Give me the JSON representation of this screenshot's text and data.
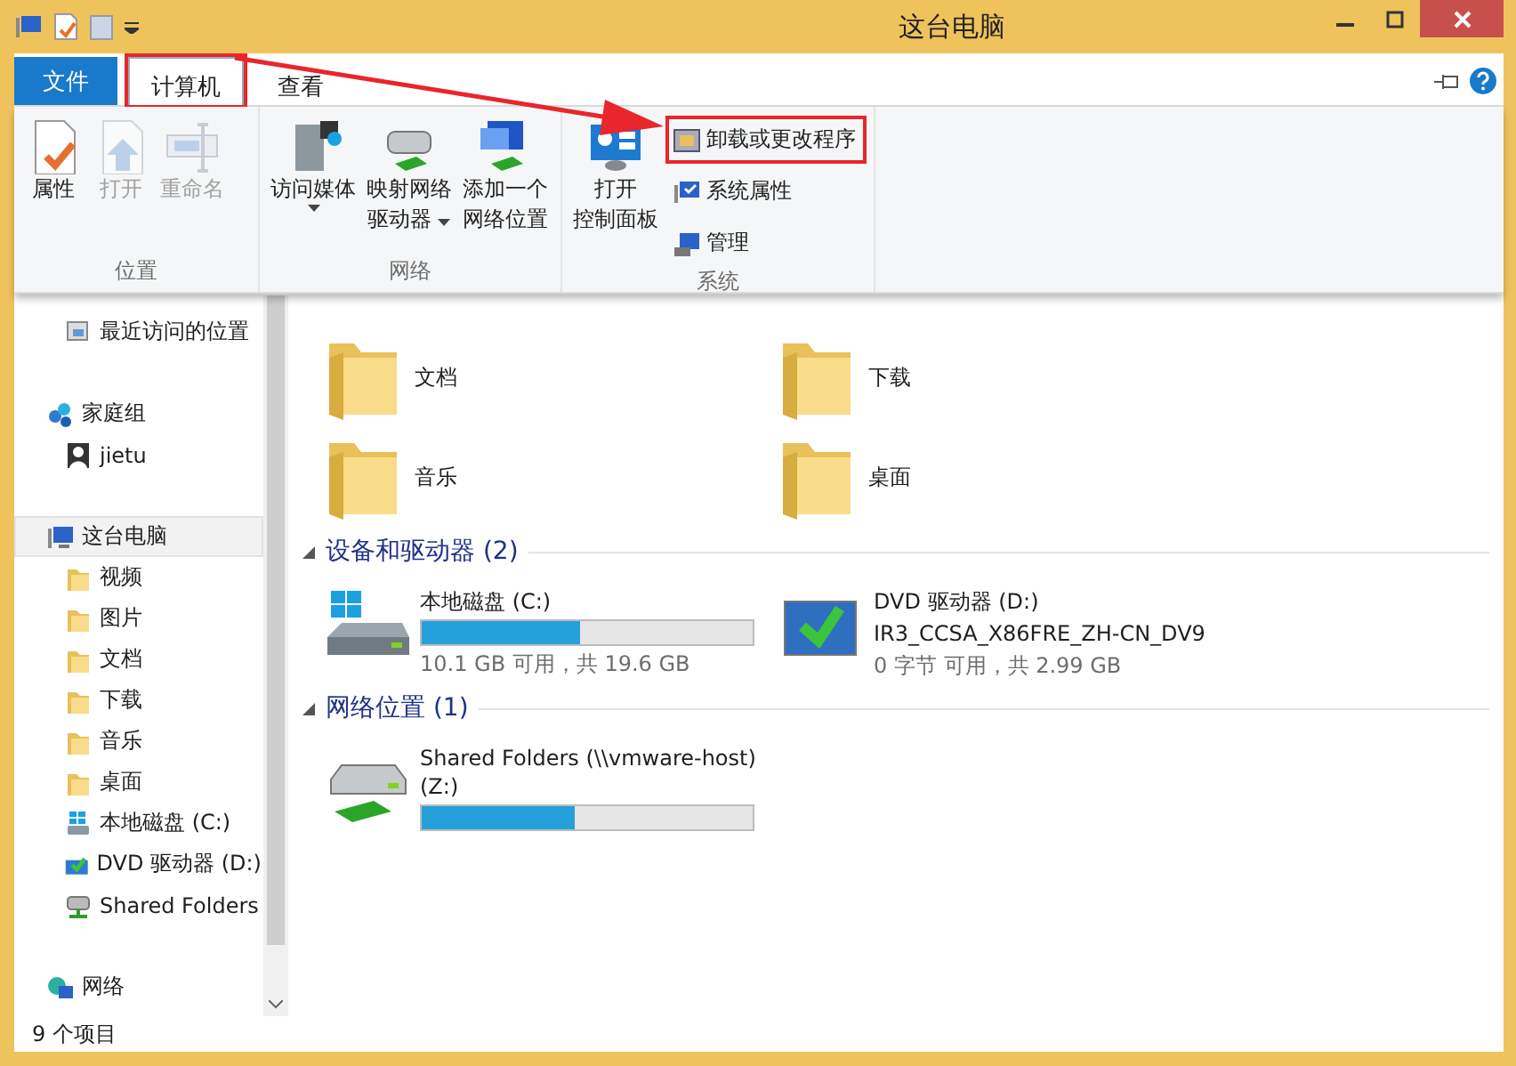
{
  "window": {
    "title": "这台电脑"
  },
  "tabs": [
    {
      "label": "文件",
      "kind": "file",
      "selected": false
    },
    {
      "label": "计算机",
      "kind": "tab",
      "selected": true,
      "highlighted": true
    },
    {
      "label": "查看",
      "kind": "tab",
      "selected": false
    }
  ],
  "ribbon": {
    "groups": [
      {
        "label": "位置",
        "buttons": [
          {
            "lines": [
              "属性"
            ],
            "kind": "properties",
            "disabled": false
          },
          {
            "lines": [
              "打开"
            ],
            "kind": "open",
            "disabled": true
          },
          {
            "lines": [
              "重命名"
            ],
            "kind": "rename",
            "disabled": true
          }
        ]
      },
      {
        "label": "网络",
        "buttons": [
          {
            "lines": [
              "访问媒体"
            ],
            "kind": "media",
            "disabled": false,
            "dropdown": true
          },
          {
            "lines": [
              "映射网络",
              "驱动器"
            ],
            "kind": "mapdrive",
            "disabled": false,
            "dropdown": true
          },
          {
            "lines": [
              "添加一个",
              "网络位置"
            ],
            "kind": "netlocation",
            "disabled": false
          }
        ]
      },
      {
        "label": "系统",
        "buttons": [
          {
            "lines": [
              "打开",
              "控制面板"
            ],
            "kind": "controlpanel",
            "disabled": false
          },
          {
            "lines": [
              "卸载或更改程序"
            ],
            "kind": "uninstall",
            "disabled": false,
            "highlighted": true
          },
          {
            "lines": [
              "系统属性"
            ],
            "kind": "sysprops",
            "disabled": false
          },
          {
            "lines": [
              "管理"
            ],
            "kind": "manage",
            "disabled": false
          }
        ]
      }
    ]
  },
  "navigation": [
    {
      "label": "最近访问的位置",
      "kind": "recent",
      "selected": false
    },
    {
      "label": "家庭组",
      "kind": "homegroup",
      "selected": false,
      "children": [
        {
          "label": "jietu",
          "kind": "user",
          "selected": false
        }
      ]
    },
    {
      "label": "这台电脑",
      "kind": "pc",
      "selected": true,
      "children": [
        {
          "label": "视频",
          "kind": "folder",
          "selected": false
        },
        {
          "label": "图片",
          "kind": "folder",
          "selected": false
        },
        {
          "label": "文档",
          "kind": "folder",
          "selected": false
        },
        {
          "label": "下载",
          "kind": "folder",
          "selected": false
        },
        {
          "label": "音乐",
          "kind": "folder",
          "selected": false
        },
        {
          "label": "桌面",
          "kind": "folder",
          "selected": false
        },
        {
          "label": "本地磁盘 (C:)",
          "kind": "disk",
          "selected": false
        },
        {
          "label": "DVD 驱动器 (D:)",
          "kind": "dvd",
          "selected": false
        },
        {
          "label": "Shared Folders",
          "kind": "share",
          "selected": false
        }
      ]
    },
    {
      "label": "网络",
      "kind": "network",
      "selected": false
    }
  ],
  "folders": [
    {
      "label": "文档"
    },
    {
      "label": "下载"
    },
    {
      "label": "音乐"
    },
    {
      "label": "桌面"
    }
  ],
  "sections": [
    {
      "title": "设备和驱动器 (2)",
      "expanded": true,
      "items": [
        {
          "kind": "disk",
          "name": "本地磁盘 (C:)",
          "level": 0.48,
          "detail": "10.1 GB 可用，共 19.6 GB"
        },
        {
          "kind": "dvd",
          "name": "DVD 驱动器 (D:)",
          "volume": "IR3_CCSA_X86FRE_ZH-CN_DV9",
          "detail": "0 字节 可用，共 2.99 GB"
        }
      ]
    },
    {
      "title": "网络位置 (1)",
      "expanded": true,
      "items": [
        {
          "kind": "share",
          "name": "Shared Folders (\\\\vmware-host)\n(Z:)",
          "level": 0.46
        }
      ]
    }
  ],
  "status_bar": {
    "count": "9 个项目"
  }
}
